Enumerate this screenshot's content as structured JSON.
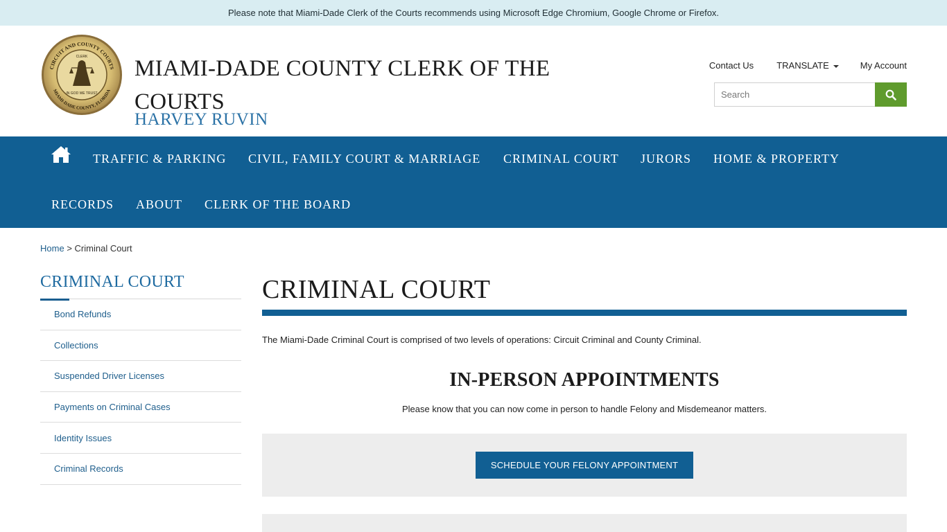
{
  "notice": {
    "text": "Please note that Miami-Dade Clerk of the Courts recommends using Microsoft Edge Chromium, Google Chrome or Firefox."
  },
  "header": {
    "seal_text_top": "CIRCUIT AND COUNTY COURTS",
    "seal_text_center": "CLERK",
    "seal_text_motto": "IN GOD WE TRUST",
    "seal_text_bottom": "MIAMI-DADE COUNTY, FLORIDA",
    "title": "MIAMI-DADE COUNTY CLERK OF THE COURTS",
    "subtitle": "HARVEY RUVIN",
    "contact_label": "Contact Us",
    "translate_label": "TRANSLATE",
    "account_label": "My Account",
    "search_placeholder": "Search"
  },
  "nav": {
    "items": [
      "TRAFFIC & PARKING",
      "CIVIL, FAMILY COURT & MARRIAGE",
      "CRIMINAL COURT",
      "JURORS",
      "HOME & PROPERTY",
      "RECORDS",
      "ABOUT",
      "CLERK OF THE BOARD"
    ]
  },
  "breadcrumb": {
    "home": "Home",
    "separator": ">",
    "current": "Criminal Court"
  },
  "sidebar": {
    "title": "CRIMINAL COURT",
    "items": [
      "Bond Refunds",
      "Collections",
      "Suspended Driver Licenses",
      "Payments on Criminal Cases",
      "Identity Issues",
      "Criminal Records"
    ]
  },
  "main": {
    "title": "CRIMINAL COURT",
    "intro": "The Miami-Dade Criminal Court is comprised of two levels of operations: Circuit Criminal and County Criminal.",
    "section_title": "IN-PERSON APPOINTMENTS",
    "section_text": "Please know that you can now come in person to handle Felony and Misdemeanor matters.",
    "felony_button": "SCHEDULE YOUR FELONY APPOINTMENT"
  },
  "colors": {
    "nav_blue": "#115f93",
    "search_green": "#5f9b2d",
    "notice_bg": "#d9edf2",
    "link_blue": "#1e5e8c"
  },
  "icons": {
    "home": "home-icon",
    "search": "search-icon",
    "translate_caret": "caret-down-icon",
    "seal": "court-seal-logo"
  }
}
